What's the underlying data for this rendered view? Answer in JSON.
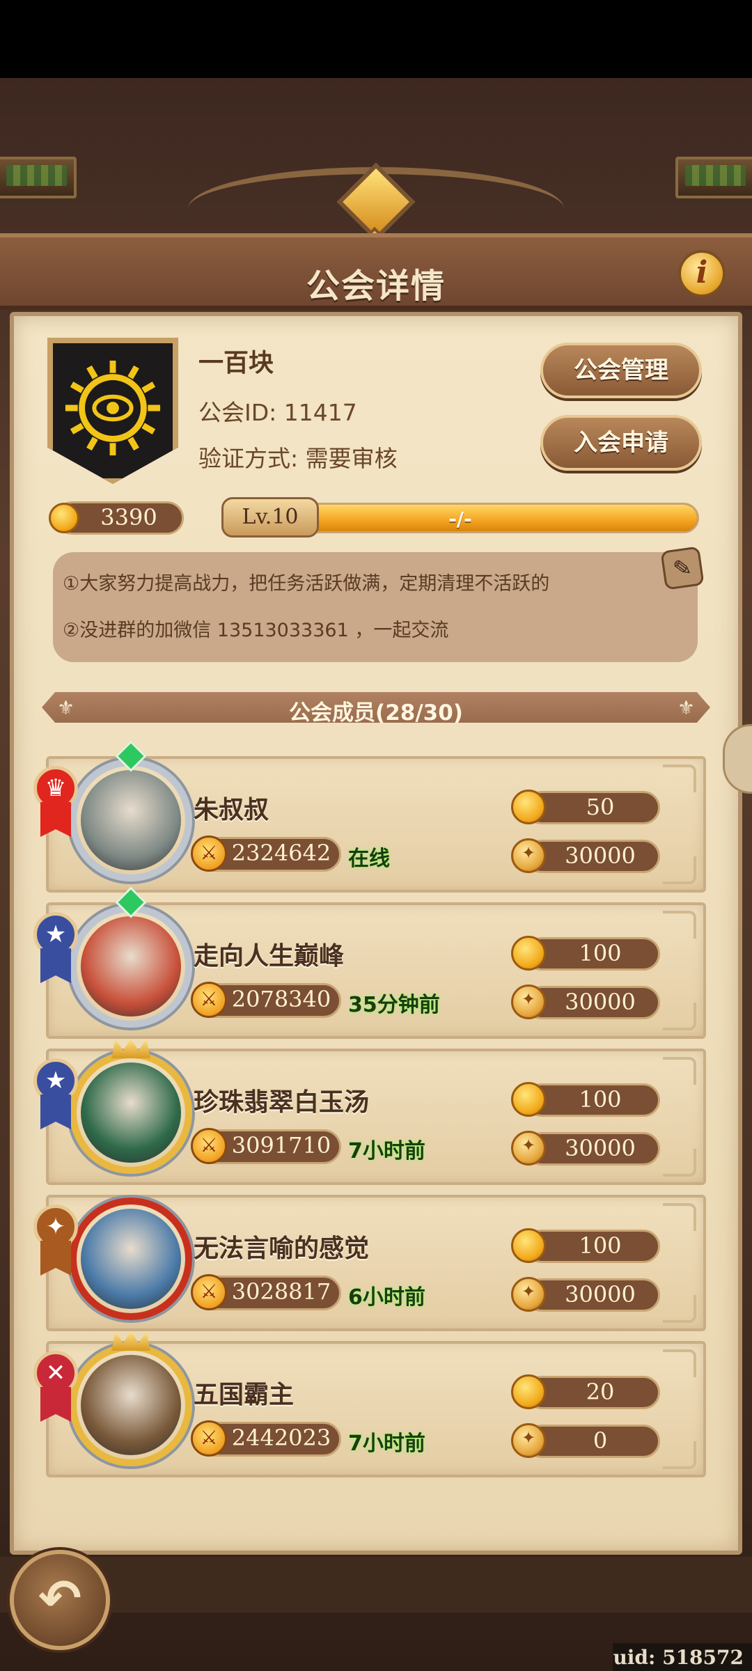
{
  "header": {
    "title": "公会详情",
    "info_icon": "i"
  },
  "guild": {
    "name": "一百块",
    "id_text": "公会ID: 11417",
    "verify_text": "验证方式: 需要审核",
    "fund": "3390",
    "level": "Lv.10",
    "exp_text": "-/-",
    "exp_fraction": 1.0,
    "buttons": {
      "manage": "公会管理",
      "apply": "入会申请"
    },
    "notice": [
      "①大家努力提高战力，把任务活跃做满，定期清理不活跃的",
      "②没进群的加微信 13513033361 ，一起交流"
    ],
    "emblem_color": "#f2c418"
  },
  "members_header": "公会成员(28/30)",
  "members": [
    {
      "name": "朱叔叔",
      "power": "2324642",
      "status": "在线",
      "contribution": "50",
      "donation": "30000",
      "rank": "leader",
      "rank_color": "#e0261e",
      "rank_symbol": "♛",
      "avatar_color": "#7f8a86",
      "frame": "silver-gem"
    },
    {
      "name": "走向人生巅峰",
      "power": "2078340",
      "status": "35分钟前",
      "contribution": "100",
      "donation": "30000",
      "rank": "officer",
      "rank_color": "#3a4ea0",
      "rank_symbol": "★",
      "avatar_color": "#c8503a",
      "frame": "silver-gem"
    },
    {
      "name": "珍珠翡翠白玉汤",
      "power": "3091710",
      "status": "7小时前",
      "contribution": "100",
      "donation": "30000",
      "rank": "officer",
      "rank_color": "#3a4ea0",
      "rank_symbol": "★",
      "avatar_color": "#2e6a4a",
      "frame": "gold-crown"
    },
    {
      "name": "无法言喻的感觉",
      "power": "3028817",
      "status": "6小时前",
      "contribution": "100",
      "donation": "30000",
      "rank": "elite",
      "rank_color": "#a85a20",
      "rank_symbol": "✦",
      "avatar_color": "#4a7aa8",
      "frame": "red"
    },
    {
      "name": "五国霸主",
      "power": "2442023",
      "status": "7小时前",
      "contribution": "20",
      "donation": "0",
      "rank": "member",
      "rank_color": "#c82838",
      "rank_symbol": "✕",
      "avatar_color": "#7a5a3a",
      "frame": "gold-crown"
    }
  ],
  "footer": {
    "back_icon": "back-arrow-icon",
    "uid": "uid: 518572"
  }
}
